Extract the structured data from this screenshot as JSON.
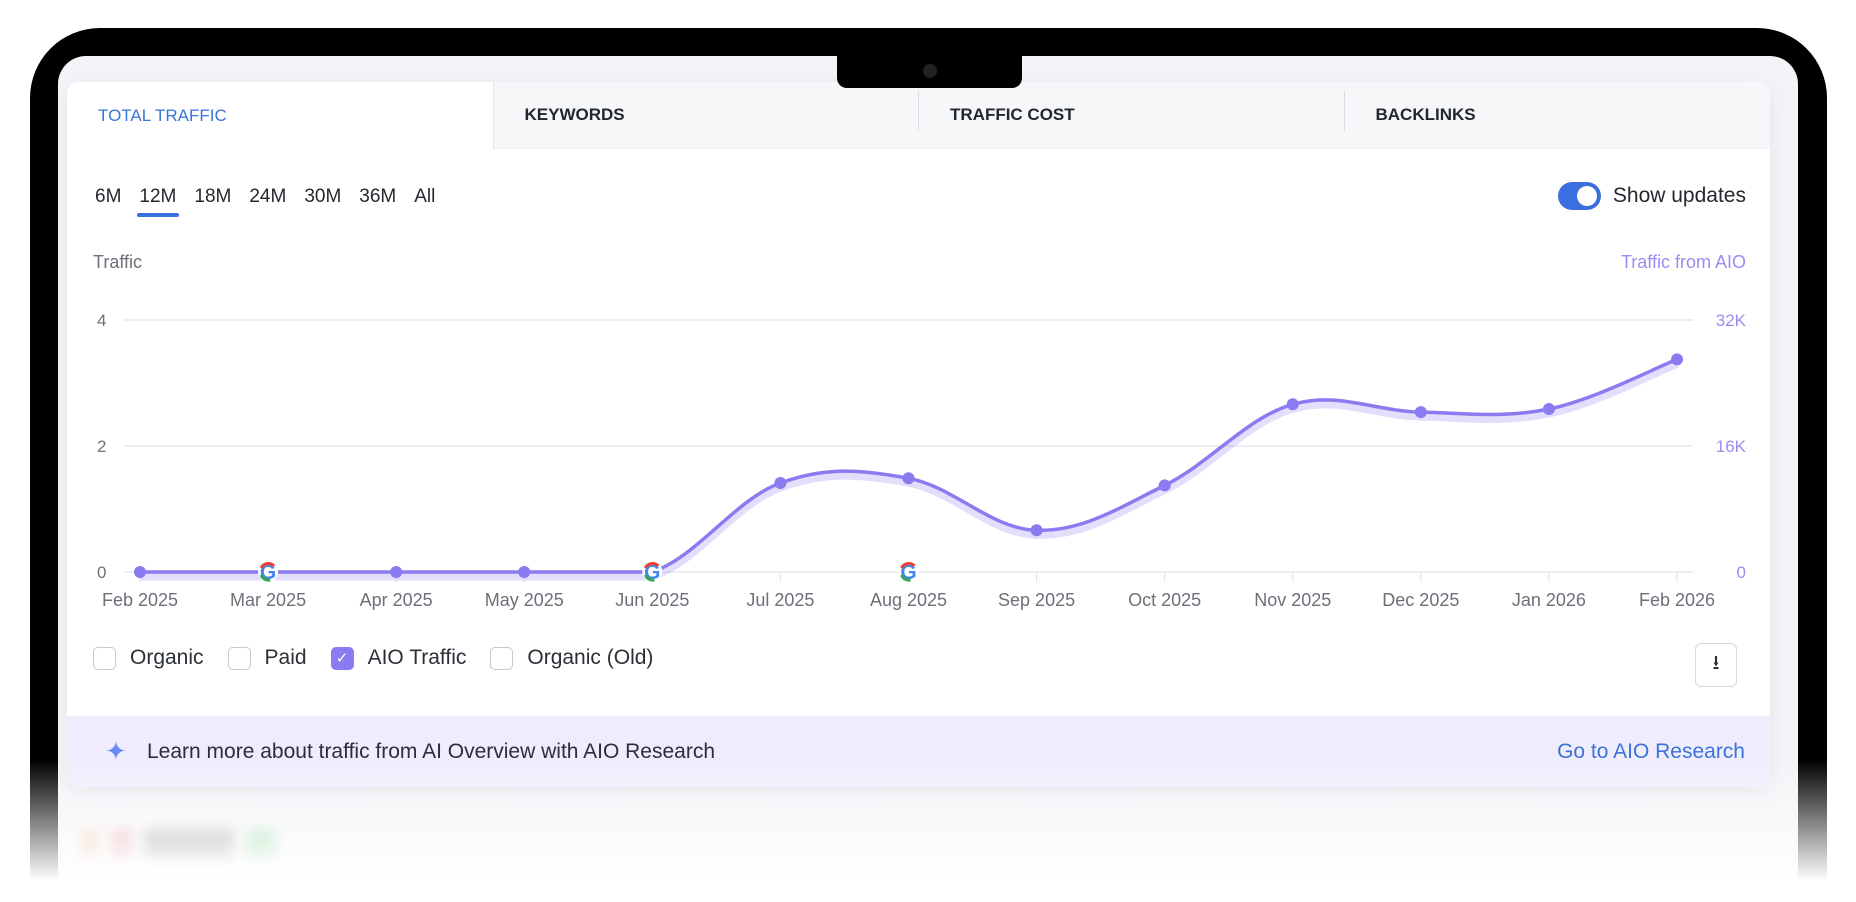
{
  "tabs": [
    {
      "label": "TOTAL TRAFFIC",
      "active": true
    },
    {
      "label": "KEYWORDS"
    },
    {
      "label": "TRAFFIC COST"
    },
    {
      "label": "BACKLINKS"
    }
  ],
  "periods": [
    "6M",
    "12M",
    "18M",
    "24M",
    "30M",
    "36M",
    "All"
  ],
  "active_period": "12M",
  "show_updates": {
    "label": "Show updates",
    "on": true
  },
  "legend": [
    {
      "label": "Organic",
      "checked": false
    },
    {
      "label": "Paid",
      "checked": false
    },
    {
      "label": "AIO Traffic",
      "checked": true
    },
    {
      "label": "Organic (Old)",
      "checked": false
    }
  ],
  "banner": {
    "text": "Learn more about traffic from AI Overview with AIO Research",
    "link": "Go to AIO Research"
  },
  "colors": {
    "accent": "#3b73d8",
    "aio": "#8a7cf0"
  },
  "chart_data": {
    "type": "line",
    "ylabel_left": "Traffic",
    "ylabel_right": "Traffic from AIO",
    "left_ticks": [
      "0",
      "2",
      "4"
    ],
    "left_ylim": [
      0,
      4
    ],
    "right_ticks": [
      "0",
      "16K",
      "32K"
    ],
    "right_ylim": [
      0,
      32000
    ],
    "categories": [
      "Feb 2025",
      "Mar 2025",
      "Apr 2025",
      "May 2025",
      "Jun 2025",
      "Jul 2025",
      "Aug 2025",
      "Sep 2025",
      "Oct 2025",
      "Nov 2025",
      "Dec 2025",
      "Jan 2026",
      "Feb 2026"
    ],
    "series": [
      {
        "name": "AIO Traffic",
        "axis": "right",
        "values": [
          0,
          0,
          0,
          0,
          0,
          11300,
          11900,
          5300,
          11000,
          21300,
          20300,
          20700,
          27000
        ]
      }
    ],
    "google_updates": [
      "Mar 2025",
      "Jun 2025",
      "Aug 2025"
    ],
    "grid": true
  }
}
